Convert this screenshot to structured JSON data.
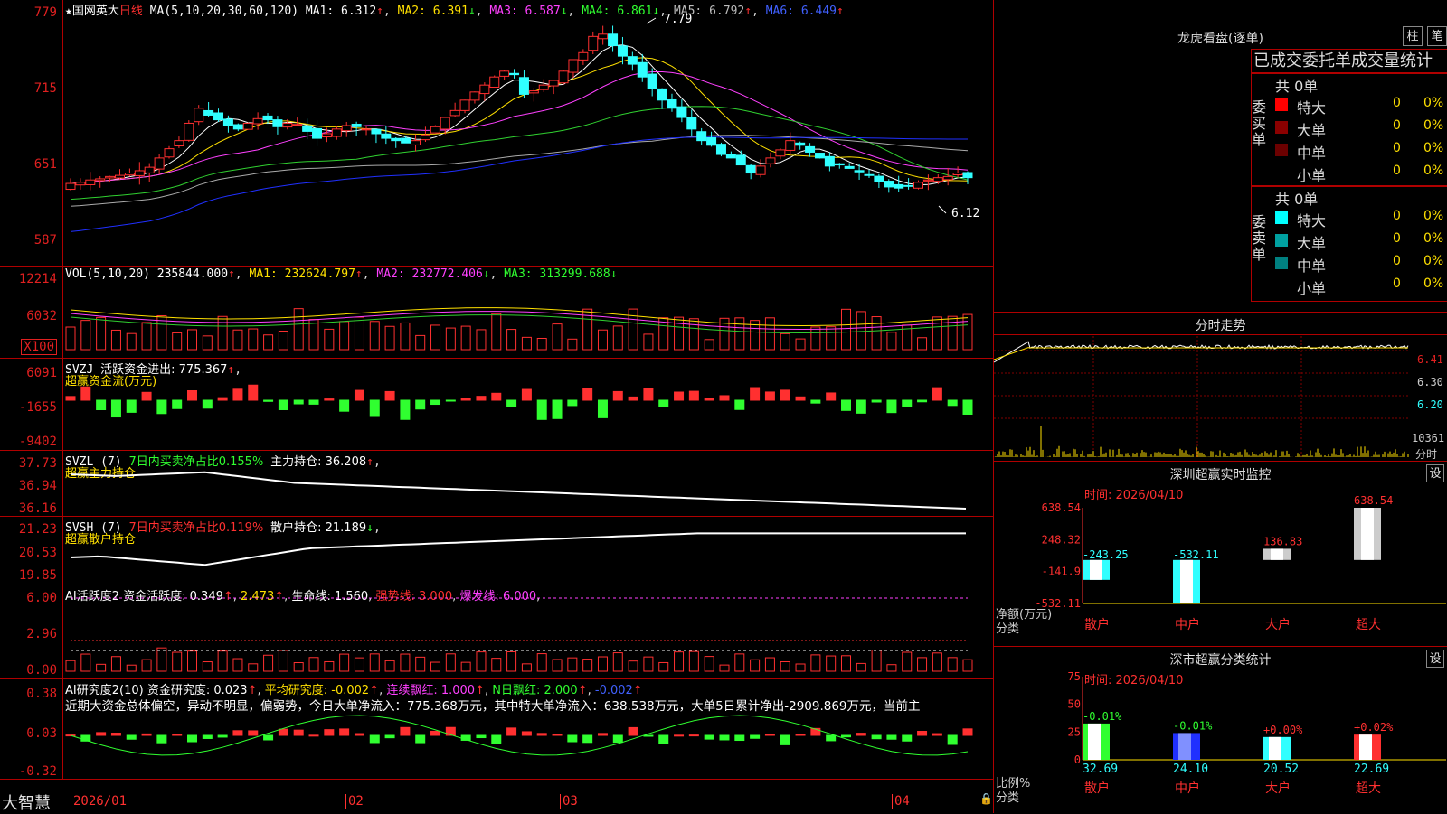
{
  "stock": {
    "name": "国网英大",
    "period": "日线"
  },
  "candle": {
    "ma_prefix": "MA(5,10,20,30,60,120)",
    "ma1": "MA1: 6.312",
    "ma2": "MA2: 6.391",
    "ma3": "MA3: 6.587",
    "ma4": "MA4: 6.861",
    "ma5": "MA5: 6.792",
    "ma6": "MA6: 6.449",
    "high_label": "7.79",
    "low_label": "6.12",
    "ticks": [
      "779",
      "715",
      "651",
      "587"
    ],
    "tick_values": [
      7.79,
      7.15,
      6.51,
      5.87
    ]
  },
  "vol": {
    "prefix": "VOL(5,10,20)",
    "value": "235844.000",
    "ma1": "MA1: 232624.797",
    "ma2": "MA2: 232772.406",
    "ma3": "MA3: 313299.688",
    "ticks": [
      "12214",
      "6032",
      "X100"
    ]
  },
  "svzj": {
    "prefix": "SVZJ",
    "label": "活跃资金进出: 775.367",
    "sub": "超赢资金流(万元)",
    "ticks": [
      "6091",
      "-1655",
      "-9402"
    ]
  },
  "svzl": {
    "prefix": "SVZL (7)",
    "a": "7日内买卖净占比0.155%",
    "b": "主力持仓: 36.208",
    "sub": "超赢主力持仓",
    "ticks": [
      "37.73",
      "36.94",
      "36.16"
    ]
  },
  "svsh": {
    "prefix": "SVSH (7)",
    "a": "7日内买卖净占比0.119%",
    "b": "散户持仓: 21.189",
    "sub": "超赢散户持仓",
    "ticks": [
      "21.23",
      "20.53",
      "19.85"
    ]
  },
  "ai1": {
    "prefix": "AI活跃度2",
    "a": "资金活跃度: 0.349",
    "b": "2.473",
    "c": "生命线: 1.560",
    "d": "强势线: 3.000",
    "e": "爆发线: 6.000",
    "ticks": [
      "6.00",
      "2.96",
      "0.00"
    ]
  },
  "ai2": {
    "prefix": "AI研究度2(10)",
    "a": "资金研究度: 0.023",
    "b": "平均研究度: -0.002",
    "c": "连续飘红: 1.000",
    "d": "N日飘红: 2.000",
    "e": "-0.002",
    "note": "近期大资金总体偏空，异动不明显，偏弱势，今日大单净流入：775.368万元，其中特大单净流入：638.538万元，大单5日累计净出-2909.869万元，当前主",
    "ticks": [
      "0.38",
      "0.03",
      "-0.32"
    ]
  },
  "bottom": {
    "brand": "大智慧",
    "dates": [
      "2026/01",
      "02",
      "03",
      "04"
    ]
  },
  "lh": {
    "title": "龙虎看盘(逐单)",
    "btn1": "柱",
    "btn2": "笔",
    "sub": "已成交委托单成交量统计",
    "buy_total": "共 0单",
    "sell_total": "共 0单",
    "buy_label": "委买单",
    "sell_label": "委卖单",
    "buy_rows": [
      {
        "name": "特大",
        "v": "0",
        "p": "0%",
        "c": "#ff0000"
      },
      {
        "name": "大单",
        "v": "0",
        "p": "0%",
        "c": "#8b0000"
      },
      {
        "name": "中单",
        "v": "0",
        "p": "0%",
        "c": "#6b0000"
      },
      {
        "name": "小单",
        "v": "0",
        "p": "0%",
        "c": ""
      }
    ],
    "sell_rows": [
      {
        "name": "特大",
        "v": "0",
        "p": "0%",
        "c": "#00ffff"
      },
      {
        "name": "大单",
        "v": "0",
        "p": "0%",
        "c": "#00a0a0"
      },
      {
        "name": "中单",
        "v": "0",
        "p": "0%",
        "c": "#008080"
      },
      {
        "name": "小单",
        "v": "0",
        "p": "0%",
        "c": ""
      }
    ]
  },
  "fs": {
    "title": "分时走势",
    "ticks": [
      "6.41",
      "6.30",
      "6.20",
      "10361",
      "分时"
    ]
  },
  "sz": {
    "title": "深圳超赢实时监控",
    "btn": "设",
    "time": "时间: 2026/04/10",
    "ticks": [
      "638.54",
      "248.32",
      "-141.9",
      "-532.11"
    ],
    "ylabel": "净额(万元)",
    "xlabel": "分类",
    "cats": [
      "散户",
      "中户",
      "大户",
      "超大"
    ],
    "values": [
      -243.25,
      -532.11,
      136.83,
      638.54
    ],
    "value_labels": [
      "-243.25",
      "-532.11",
      "136.83",
      "638.54"
    ]
  },
  "fl": {
    "title": "深市超赢分类统计",
    "btn": "设",
    "time": "时间: 2026/04/10",
    "ticks": [
      "75",
      "50",
      "25",
      "0"
    ],
    "ylabel": "比例%",
    "xlabel": "分类",
    "cats": [
      "散户",
      "中户",
      "大户",
      "超大"
    ],
    "values": [
      32.69,
      24.1,
      20.52,
      22.69
    ],
    "value_labels": [
      "32.69",
      "24.10",
      "20.52",
      "22.69"
    ],
    "chg": [
      "-0.01%",
      "-0.01%",
      "+0.00%",
      "+0.02%"
    ]
  }
}
